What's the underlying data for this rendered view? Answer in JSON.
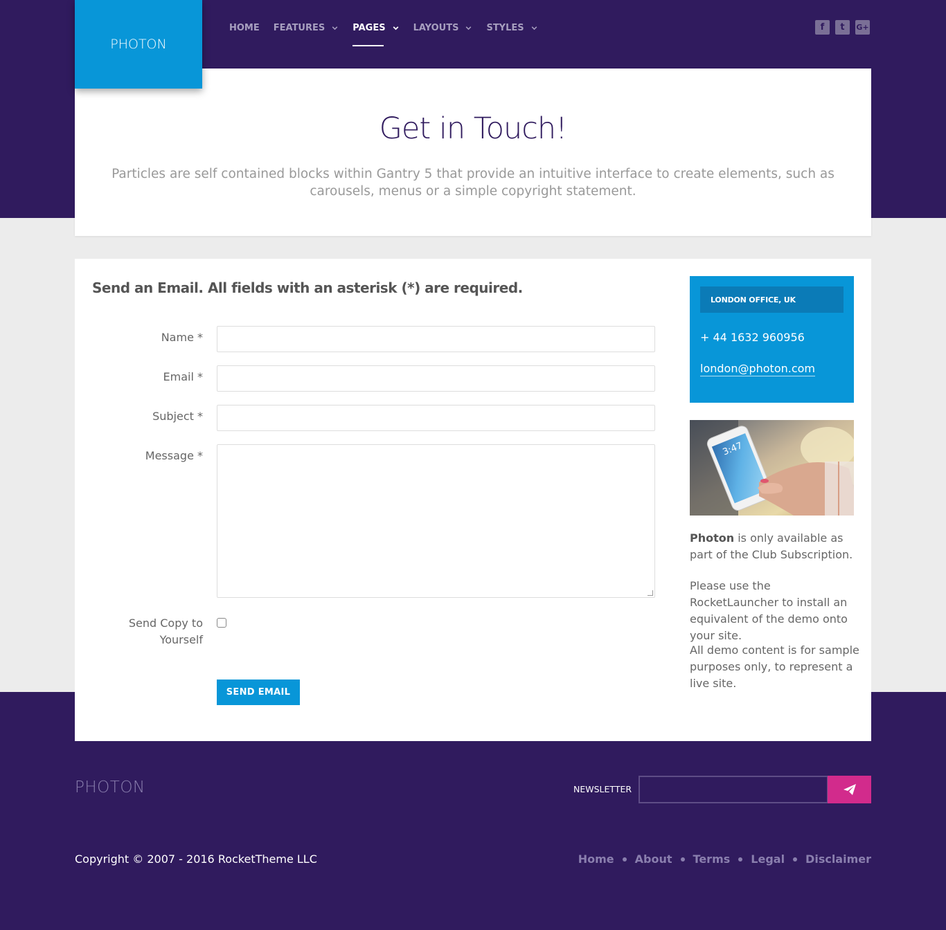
{
  "brand": {
    "logo": "PHOTON"
  },
  "nav": [
    {
      "label": "HOME",
      "dropdown": false,
      "active": false
    },
    {
      "label": "FEATURES",
      "dropdown": true,
      "active": false
    },
    {
      "label": "PAGES",
      "dropdown": true,
      "active": true
    },
    {
      "label": "LAYOUTS",
      "dropdown": true,
      "active": false
    },
    {
      "label": "STYLES",
      "dropdown": true,
      "active": false
    }
  ],
  "social": [
    {
      "icon": "facebook-icon",
      "glyph": "f"
    },
    {
      "icon": "twitter-icon",
      "glyph": "t"
    },
    {
      "icon": "google-plus-icon",
      "glyph": "G+"
    }
  ],
  "hero": {
    "title": "Get in Touch!",
    "subtitle": "Particles are self contained blocks within Gantry 5 that provide an intuitive interface to create elements, such as carousels, menus or a simple copyright statement."
  },
  "form": {
    "heading": "Send an Email. All fields with an asterisk (*) are required.",
    "name_label": "Name *",
    "name_value": "",
    "email_label": "Email *",
    "email_value": "",
    "subject_label": "Subject *",
    "subject_value": "",
    "message_label": "Message *",
    "message_value": "",
    "copy_label": "Send Copy to Yourself",
    "copy_checked": false,
    "submit_label": "SEND EMAIL"
  },
  "office": {
    "heading": "LONDON OFFICE, UK",
    "phone": "+ 44 1632 960956",
    "email": "london@photon.com"
  },
  "sidebar": {
    "brand_bold": "Photon",
    "p1_rest": " is only available as part of the Club Subscription.",
    "p2": "Please use the RocketLauncher to install an equivalent of the demo onto your site.",
    "p3": "All demo content is for sample purposes only, to represent a live site."
  },
  "footer": {
    "logo": "PHOTON",
    "newsletter_label": "NEWSLETTER",
    "newsletter_value": "",
    "copyright": "Copyright © 2007 - 2016 RocketTheme LLC",
    "links": [
      "Home",
      "About",
      "Terms",
      "Legal",
      "Disclaimer"
    ]
  },
  "colors": {
    "purple": "#301b5e",
    "blue": "#0896d8",
    "pink": "#d22b8c"
  }
}
